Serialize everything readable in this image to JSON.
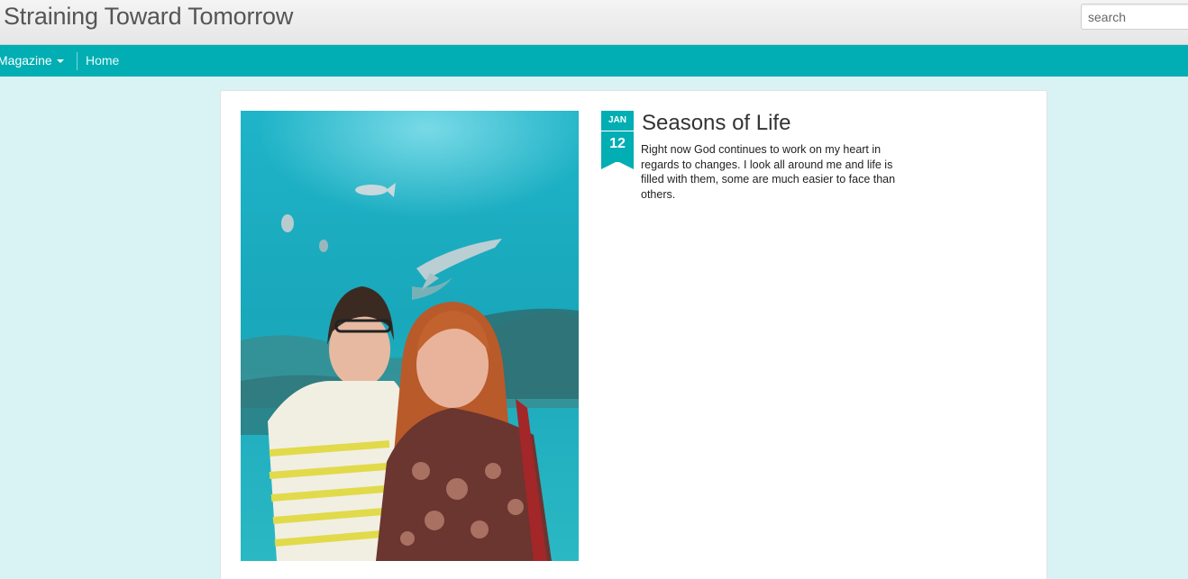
{
  "header": {
    "site_title": "Straining Toward Tomorrow",
    "search_placeholder": "search"
  },
  "nav": {
    "items": [
      {
        "label": "Magazine",
        "has_dropdown": true
      },
      {
        "label": "Home"
      }
    ]
  },
  "post": {
    "date_month": "JAN",
    "date_day": "12",
    "title": "Seasons of Life",
    "excerpt": "Right now God continues to work on my heart in regards to changes.  I look all around me and life is filled with them, some are much easier to face than others."
  },
  "colors": {
    "accent": "#00aeb3",
    "page_bg": "#d9f2f3"
  }
}
